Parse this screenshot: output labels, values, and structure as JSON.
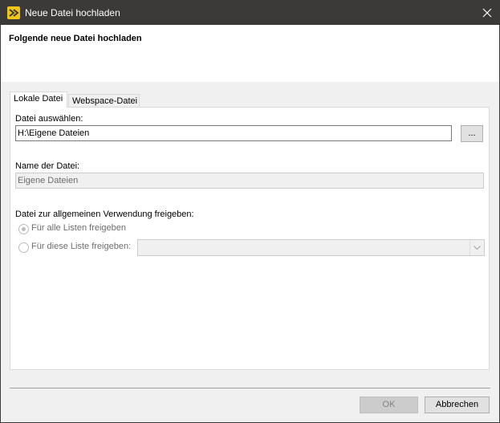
{
  "window": {
    "title": "Neue Datei hochladen",
    "icon": "app-logo-icon"
  },
  "header": {
    "title": "Folgende neue Datei hochladen"
  },
  "tabs": [
    {
      "label": "Lokale Datei",
      "active": true
    },
    {
      "label": "Webspace-Datei",
      "active": false
    }
  ],
  "file_select": {
    "label": "Datei auswählen:",
    "value": "H:\\Eigene Dateien",
    "browse_label": "..."
  },
  "file_name": {
    "label": "Name der Datei:",
    "value": "Eigene Dateien"
  },
  "share": {
    "label": "Datei zur allgemeinen Verwendung freigeben:",
    "option_all": "Für alle Listen freigeben",
    "option_this": "Für diese Liste freigeben:",
    "selected": "all",
    "list_value": ""
  },
  "buttons": {
    "ok": "OK",
    "cancel": "Abbrechen"
  },
  "colors": {
    "titlebar": "#3c3a39",
    "icon_accent": "#f2c419"
  }
}
